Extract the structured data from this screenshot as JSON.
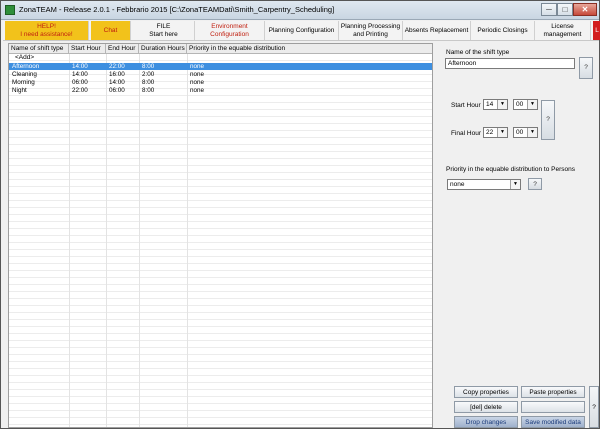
{
  "window": {
    "title": "ZonaTEAM - Release 2.0.1 - Febbrario 2015 [C:\\ZonaTEAMDati\\Smith_Carpentry_Scheduling]",
    "min_label": "─",
    "max_label": "□",
    "close_label": "✕"
  },
  "menu": {
    "help_line1": "HELP!",
    "help_line2": "I need assistance!",
    "chat": "Chat",
    "file_line1": "FILE",
    "file_line2": "Start here",
    "env_line1": "Environment",
    "env_line2": "Configuration",
    "planning_config": "Planning Configuration",
    "ppp_line1": "Planning Processing",
    "ppp_line2": "and Printing",
    "absents": "Absents Replacement",
    "periodic": "Periodic Closings",
    "license_line1": "License",
    "license_line2": "management",
    "red_tab": "L"
  },
  "grid": {
    "columns": [
      "Name of shift type",
      "Start Hour",
      "End Hour",
      "Duration Hours",
      "Priority in the equable distribution"
    ],
    "add_label": "<Add>",
    "rows": [
      {
        "name": "Afternoon",
        "start": "14:00",
        "end": "22:00",
        "duration": "8:00",
        "priority": "none",
        "selected": true
      },
      {
        "name": "Cleaning",
        "start": "14:00",
        "end": "16:00",
        "duration": "2:00",
        "priority": "none",
        "selected": false
      },
      {
        "name": "Morning",
        "start": "06:00",
        "end": "14:00",
        "duration": "8:00",
        "priority": "none",
        "selected": false
      },
      {
        "name": "Night",
        "start": "22:00",
        "end": "06:00",
        "duration": "8:00",
        "priority": "none",
        "selected": false
      }
    ]
  },
  "form": {
    "name_label": "Name of the shift type",
    "name_value": "Afternoon",
    "start_label": "Start Hour",
    "start_hour": "14",
    "start_min": "00",
    "final_label": "Final Hour",
    "final_hour": "22",
    "final_min": "00",
    "priority_label": "Priority in the equable distribution to Persons",
    "priority_value": "none",
    "help_q": "?"
  },
  "buttons": {
    "copy": "Copy properties",
    "paste": "Paste properties",
    "delete": "[del] delete",
    "drop": "Drop changes",
    "save": "Save modified data",
    "side_q": "?"
  },
  "icons": {
    "app": "zonateam-app-icon",
    "dropdown": "chevron-down-icon"
  }
}
